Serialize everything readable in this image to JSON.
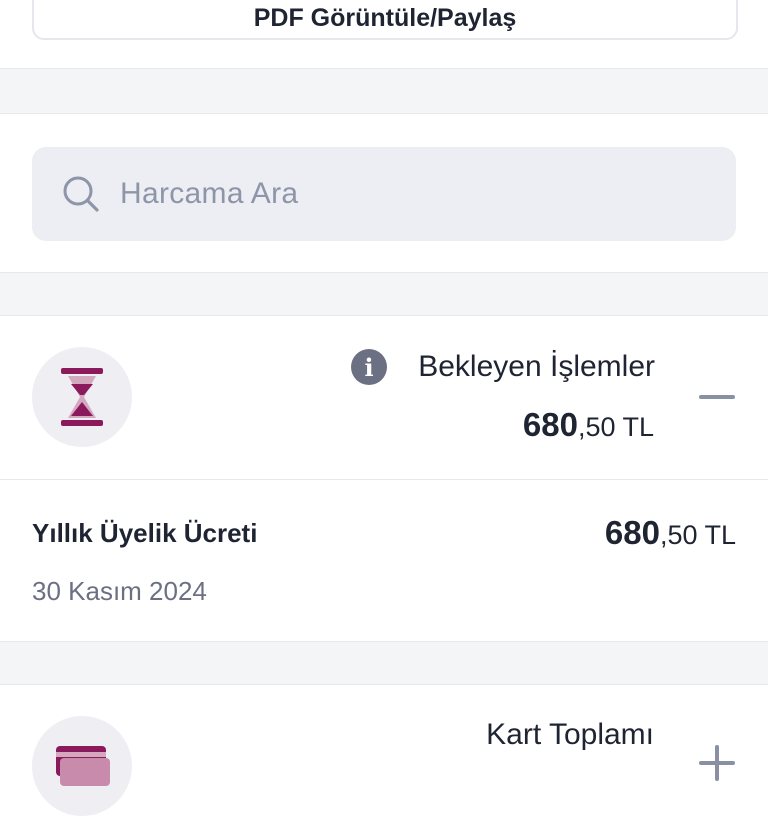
{
  "top": {
    "pdf_button_label": "PDF Görüntüle/Paylaş"
  },
  "search": {
    "placeholder": "Harcama Ara",
    "icon": "search-icon"
  },
  "pending": {
    "title": "Bekleyen İşlemler",
    "amount_int": "680",
    "amount_dec": ",50 TL",
    "icon": "hourglass-icon",
    "info_icon": "info-icon",
    "accent": "#8a1a5c"
  },
  "transaction": {
    "title": "Yıllık Üyelik Ücreti",
    "date": "30 Kasım 2024",
    "amount_int": "680",
    "amount_dec": ",50 TL"
  },
  "card_total": {
    "title": "Kart Toplamı",
    "icon": "card-icon"
  },
  "colors": {
    "accent": "#8a1a5c",
    "muted": "#6b7083",
    "bg_gap": "#f4f5f7"
  }
}
